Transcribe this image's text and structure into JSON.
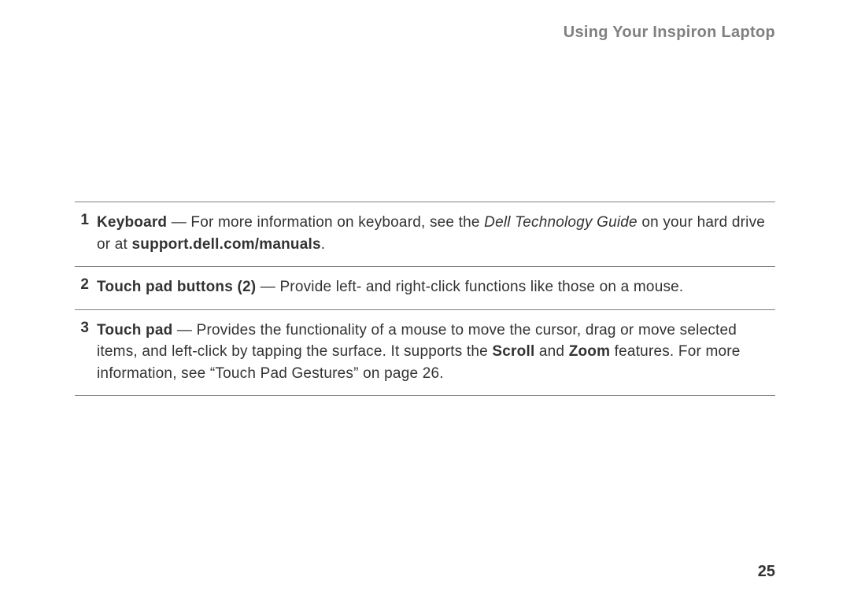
{
  "header": {
    "title": "Using Your Inspiron Laptop"
  },
  "items": [
    {
      "number": "1",
      "label": "Keyboard",
      "sep": " — ",
      "pre": "For more information on keyboard, see the ",
      "italic": "Dell Technology Guide",
      "mid": " on your hard drive or at ",
      "bold2": "support.dell.com/manuals",
      "post": "."
    },
    {
      "number": "2",
      "label": "Touch pad buttons (2)",
      "sep": " — ",
      "pre": "Provide left- and right-click functions like those on a mouse.",
      "italic": "",
      "mid": "",
      "bold2": "",
      "post": ""
    },
    {
      "number": "3",
      "label": "Touch pad",
      "sep": " — ",
      "pre": "Provides the functionality of a mouse to move the cursor, drag or move selected items, and left-click by tapping the surface. It supports the ",
      "bold2": "Scroll",
      "mid": " and ",
      "bold3": "Zoom",
      "post": " features. For more information, see “Touch Pad Gestures” on page 26."
    }
  ],
  "page_number": "25"
}
